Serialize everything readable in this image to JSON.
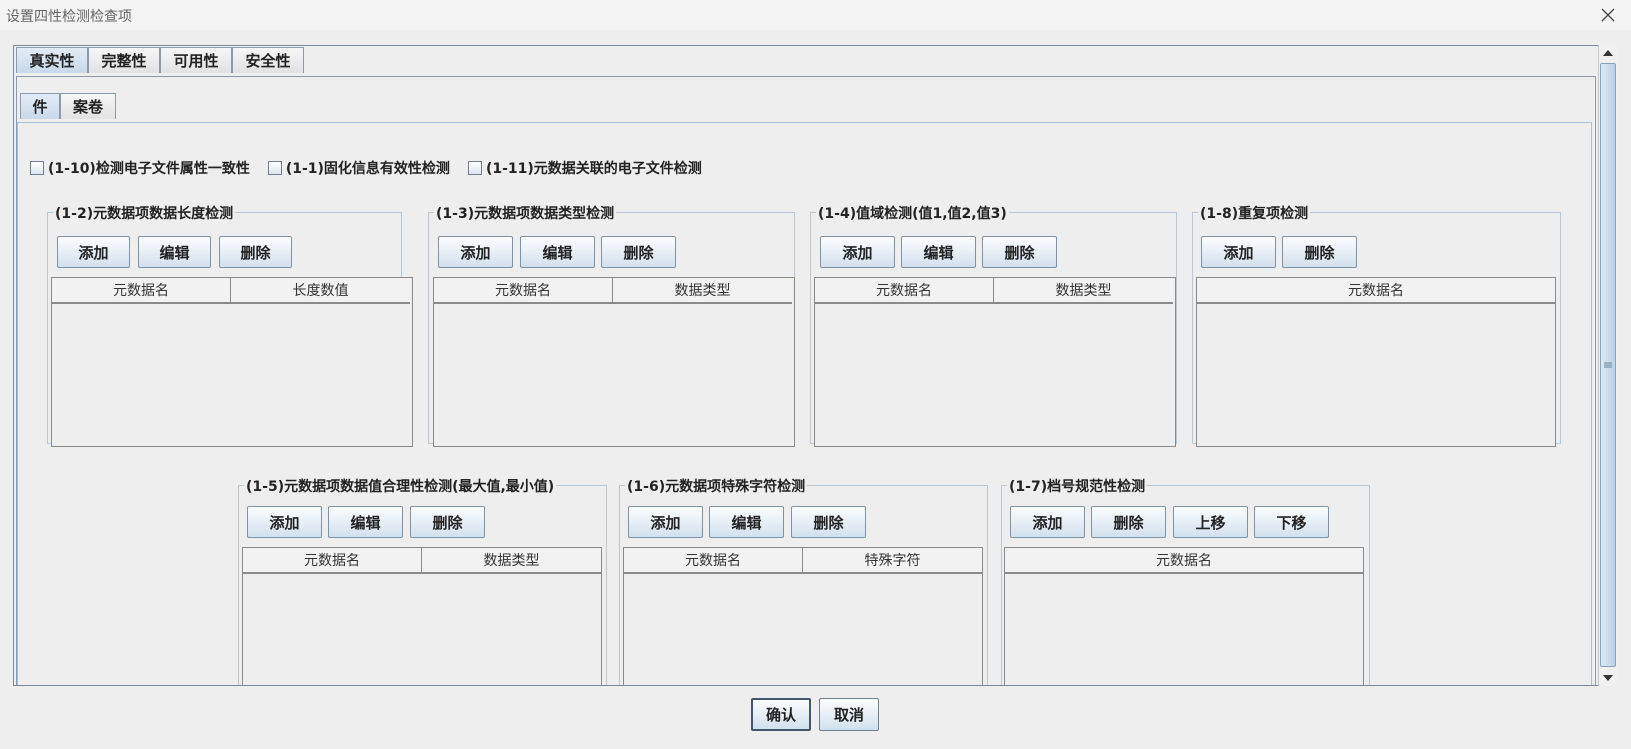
{
  "window": {
    "title": "设置四性检测检查项",
    "close_icon": "close-icon"
  },
  "tabs": [
    "真实性",
    "完整性",
    "可用性",
    "安全性"
  ],
  "subtabs": [
    "件",
    "案卷"
  ],
  "checkboxes": [
    {
      "label": "(1-10)检测电子文件属性一致性",
      "checked": false
    },
    {
      "label": "(1-1)固化信息有效性检测",
      "checked": false
    },
    {
      "label": "(1-11)元数据关联的电子文件检测",
      "checked": false
    }
  ],
  "groups": [
    {
      "legend": "(1-2)元数据项数据长度检测",
      "buttons": [
        "添加",
        "编辑",
        "删除"
      ],
      "columns": [
        "元数据名",
        "长度数值"
      ]
    },
    {
      "legend": "(1-3)元数据项数据类型检测",
      "buttons": [
        "添加",
        "编辑",
        "删除"
      ],
      "columns": [
        "元数据名",
        "数据类型"
      ]
    },
    {
      "legend": "(1-4)值域检测(值1,值2,值3)",
      "buttons": [
        "添加",
        "编辑",
        "删除"
      ],
      "columns": [
        "元数据名",
        "数据类型"
      ]
    },
    {
      "legend": "(1-8)重复项检测",
      "buttons": [
        "添加",
        "删除"
      ],
      "columns": [
        "元数据名"
      ]
    },
    {
      "legend": "(1-5)元数据项数据值合理性检测(最大值,最小值)",
      "buttons": [
        "添加",
        "编辑",
        "删除"
      ],
      "columns": [
        "元数据名",
        "数据类型"
      ]
    },
    {
      "legend": "(1-6)元数据项特殊字符检测",
      "buttons": [
        "添加",
        "编辑",
        "删除"
      ],
      "columns": [
        "元数据名",
        "特殊字符"
      ]
    },
    {
      "legend": "(1-7)档号规范性检测",
      "buttons": [
        "添加",
        "删除",
        "上移",
        "下移"
      ],
      "columns": [
        "元数据名"
      ]
    }
  ],
  "footer": {
    "confirm": "确认",
    "cancel": "取消"
  }
}
